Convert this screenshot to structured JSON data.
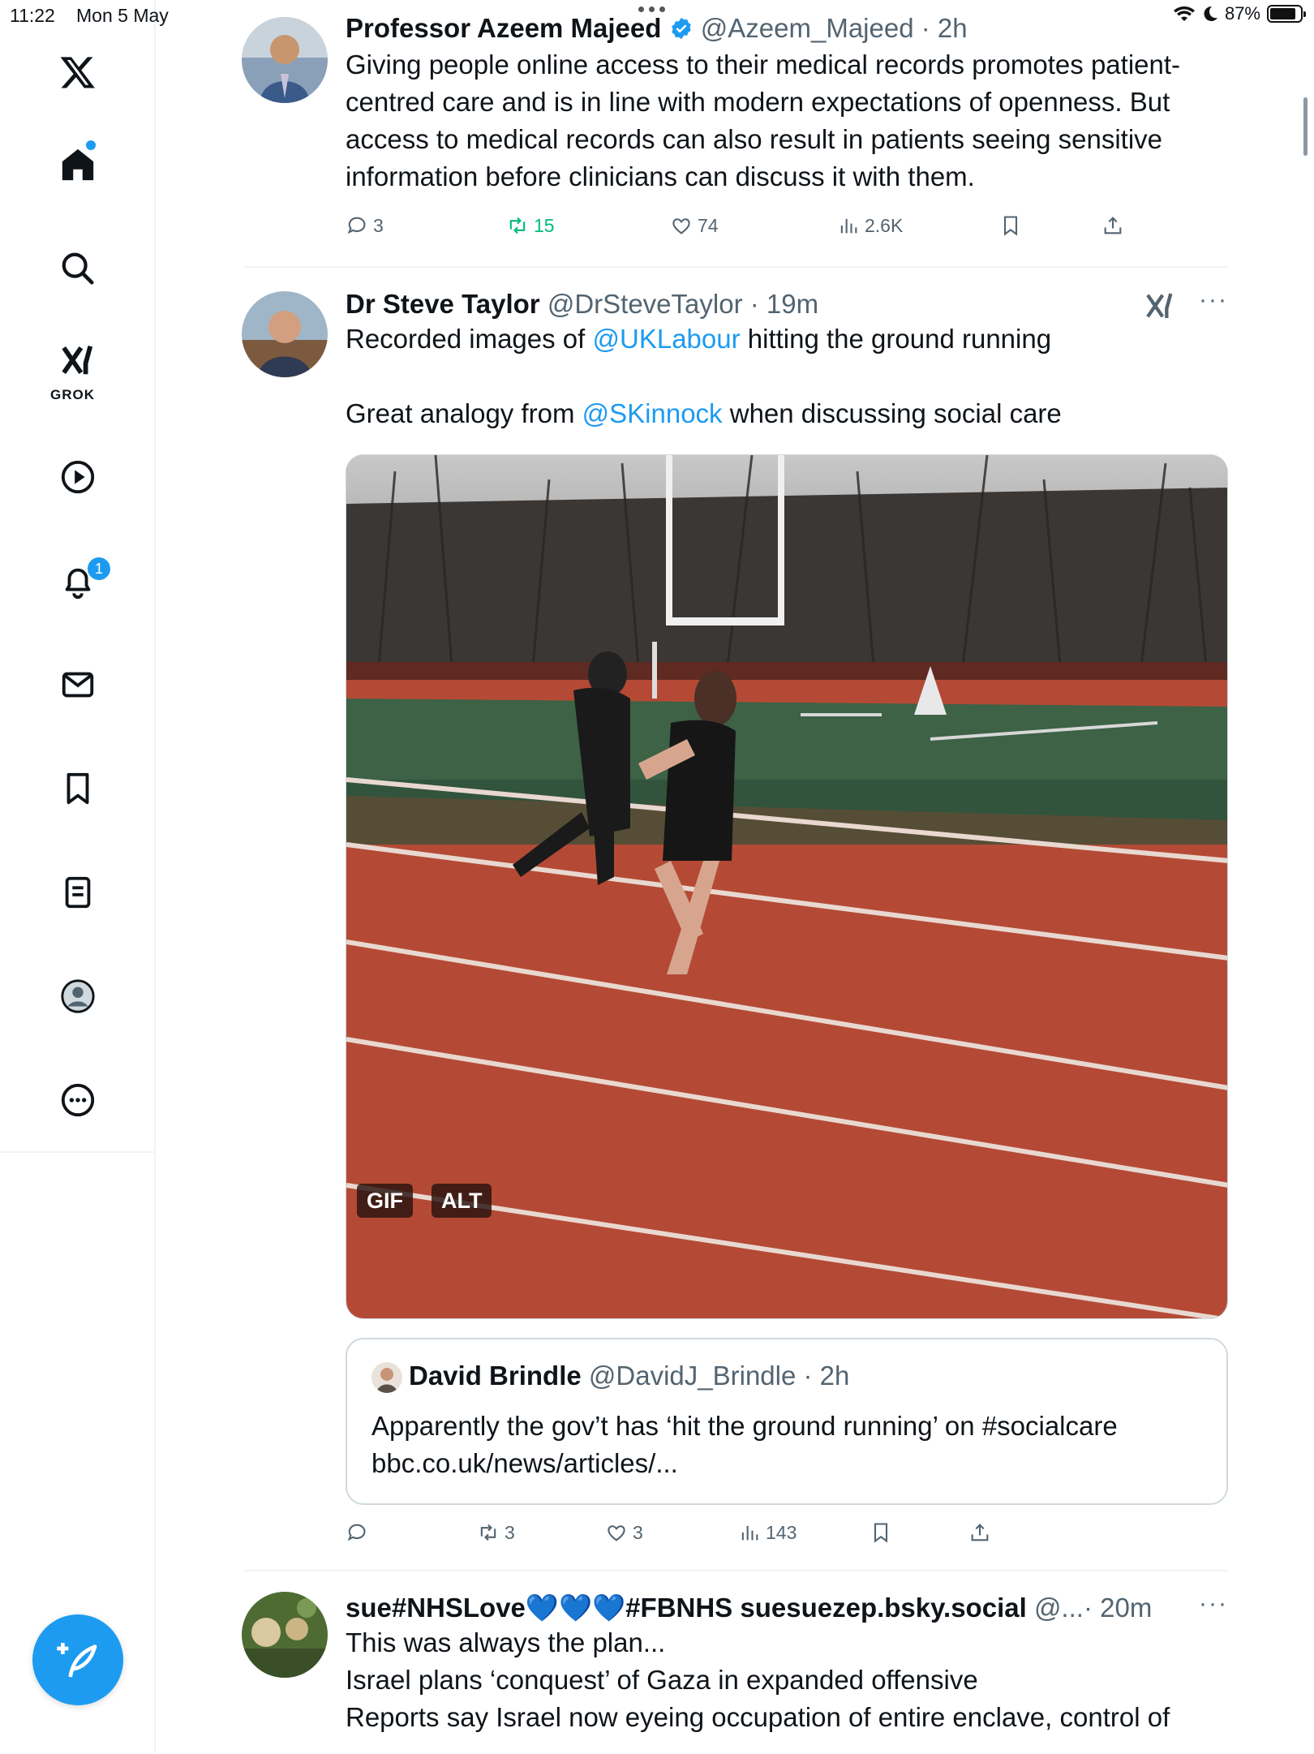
{
  "status_bar": {
    "time": "11:22",
    "date": "Mon 5 May",
    "battery": "87%",
    "battery_level": 0.87
  },
  "sidebar": {
    "items": [
      {
        "name": "x-logo-icon"
      },
      {
        "name": "home-icon"
      },
      {
        "name": "search-icon"
      },
      {
        "name": "grok-icon",
        "label": "GROK"
      },
      {
        "name": "play-icon"
      },
      {
        "name": "notifications-icon",
        "badge": "1"
      },
      {
        "name": "messages-icon"
      },
      {
        "name": "bookmarks-icon"
      },
      {
        "name": "lists-icon"
      },
      {
        "name": "profile-icon"
      },
      {
        "name": "more-icon"
      }
    ],
    "compose_icon": "compose-icon"
  },
  "tweets": [
    {
      "name": "Professor Azeem Majeed",
      "handle": "@Azeem_Majeed",
      "time": "· 2h",
      "text": "Giving people online access to their medical records promotes patient-centred care and is in line with modern expectations of openness. But access to medical records can also result in patients seeing sensitive information before clinicians can discuss it with them.",
      "replies": "3",
      "reposts": "15",
      "likes": "74",
      "views": "2.6K"
    },
    {
      "name": "Dr Steve Taylor",
      "handle": "@DrSteveTaylor",
      "time": "· 19m",
      "text_pre": "Recorded images of ",
      "mention1": "@UKLabour",
      "text_mid": " hitting the ground running",
      "text2_pre": "Great analogy from ",
      "mention2": "@SKinnock",
      "text2_post": " when discussing social care",
      "gif_label": "GIF",
      "alt_label": "ALT",
      "quote": {
        "name": "David Brindle",
        "handle": "@DavidJ_Brindle",
        "time": "· 2h",
        "text": "Apparently the gov’t has ‘hit the ground running’ on #socialcare bbc.co.uk/news/articles/..."
      },
      "replies": "",
      "reposts": "3",
      "likes": "3",
      "views": "143"
    },
    {
      "name": "sue#NHSLove💙💙💙#FBNHS suesuezep.bsky.social",
      "handle": "@...",
      "time": "· 20m",
      "line1": "This was always the plan...",
      "line2": "Israel plans ‘conquest’ of Gaza in expanded offensive",
      "line3": "Reports say Israel now eyeing occupation of entire enclave, control of"
    }
  ]
}
